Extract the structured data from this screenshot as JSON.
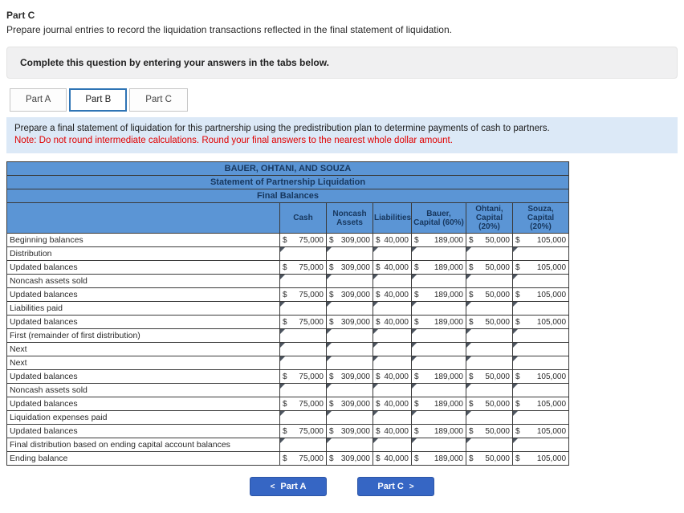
{
  "colors": {
    "header_blue": "#5B95D5",
    "header_text": "#17375E",
    "note_bg": "#DCE9F7",
    "note_red": "#E00000",
    "button_blue": "#3666C4",
    "tab_active_border": "#2E74B5",
    "panel_bg": "#F0F0F1"
  },
  "header": {
    "part_title": "Part C",
    "part_description": "Prepare journal entries to record the liquidation transactions reflected in the final statement of liquidation.",
    "instruction": "Complete this question by entering your answers in the tabs below."
  },
  "tabs": [
    {
      "id": "part-a",
      "label": "Part A",
      "active": false
    },
    {
      "id": "part-b",
      "label": "Part B",
      "active": true
    },
    {
      "id": "part-c",
      "label": "Part C",
      "active": false
    }
  ],
  "note": {
    "line1": "Prepare a final statement of liquidation for this partnership using the predistribution plan to determine payments of cash to partners.",
    "line2": "Note: Do not round intermediate calculations. Round your final answers to the nearest whole dollar amount."
  },
  "table": {
    "title_company": "BAUER, OHTANI, AND SOUZA",
    "title_statement": "Statement of Partnership Liquidation",
    "title_final": "Final Balances",
    "currency_symbol": "$",
    "columns": [
      {
        "id": "cash",
        "lines": [
          "Cash"
        ]
      },
      {
        "id": "noncash-assets",
        "lines": [
          "Noncash",
          "Assets"
        ]
      },
      {
        "id": "liabilities",
        "lines": [
          "Liabilities"
        ]
      },
      {
        "id": "bauer-capital",
        "lines": [
          "Bauer,",
          "Capital (60%)"
        ]
      },
      {
        "id": "ohtani-capital",
        "lines": [
          "Ohtani,",
          "Capital",
          "(20%)"
        ]
      },
      {
        "id": "souza-capital",
        "lines": [
          "Souza,",
          "Capital",
          "(20%)"
        ]
      }
    ],
    "rows": [
      {
        "label": "Beginning balances",
        "type": "value",
        "values": [
          "75,000",
          "309,000",
          "40,000",
          "189,000",
          "50,000",
          "105,000"
        ]
      },
      {
        "label": "Distribution",
        "type": "input"
      },
      {
        "label": "Updated balances",
        "type": "value",
        "values": [
          "75,000",
          "309,000",
          "40,000",
          "189,000",
          "50,000",
          "105,000"
        ]
      },
      {
        "label": "Noncash assets sold",
        "type": "input"
      },
      {
        "label": "Updated balances",
        "type": "value",
        "values": [
          "75,000",
          "309,000",
          "40,000",
          "189,000",
          "50,000",
          "105,000"
        ]
      },
      {
        "label": "Liabilities paid",
        "type": "input"
      },
      {
        "label": "Updated balances",
        "type": "value",
        "values": [
          "75,000",
          "309,000",
          "40,000",
          "189,000",
          "50,000",
          "105,000"
        ]
      },
      {
        "label": "First (remainder of first distribution)",
        "type": "input"
      },
      {
        "label": "Next",
        "type": "input"
      },
      {
        "label": "Next",
        "type": "input"
      },
      {
        "label": "Updated balances",
        "type": "value",
        "values": [
          "75,000",
          "309,000",
          "40,000",
          "189,000",
          "50,000",
          "105,000"
        ]
      },
      {
        "label": "Noncash assets sold",
        "type": "input"
      },
      {
        "label": "Updated balances",
        "type": "value",
        "values": [
          "75,000",
          "309,000",
          "40,000",
          "189,000",
          "50,000",
          "105,000"
        ]
      },
      {
        "label": "Liquidation expenses paid",
        "type": "input"
      },
      {
        "label": "Updated balances",
        "type": "value",
        "values": [
          "75,000",
          "309,000",
          "40,000",
          "189,000",
          "50,000",
          "105,000"
        ]
      },
      {
        "label": "Final distribution based on ending capital account balances",
        "type": "input"
      },
      {
        "label": "Ending balance",
        "type": "value",
        "values": [
          "75,000",
          "309,000",
          "40,000",
          "189,000",
          "50,000",
          "105,000"
        ]
      }
    ]
  },
  "buttons": {
    "prev_icon": "<",
    "prev_label": "Part A",
    "next_label": "Part C",
    "next_icon": ">"
  }
}
